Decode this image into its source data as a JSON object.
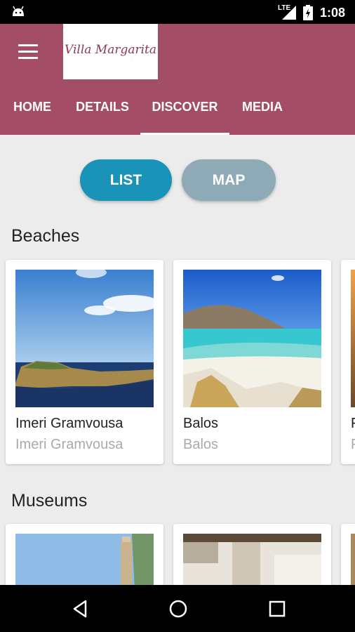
{
  "status_bar": {
    "network": "LTE",
    "time": "1:08"
  },
  "logo": {
    "text": "Villa Margarita",
    "subtext": "·"
  },
  "tabs": [
    {
      "label": "HOME"
    },
    {
      "label": "DETAILS"
    },
    {
      "label": "DISCOVER",
      "active": true
    },
    {
      "label": "MEDIA"
    }
  ],
  "view_toggle": {
    "list_label": "LIST",
    "map_label": "MAP"
  },
  "sections": {
    "beaches": {
      "title": "Beaches",
      "cards": [
        {
          "title": "Imeri Gramvousa",
          "subtitle": "Imeri Gramvousa"
        },
        {
          "title": "Balos",
          "subtitle": "Balos"
        },
        {
          "title": "F",
          "subtitle": "F"
        }
      ]
    },
    "museums": {
      "title": "Museums"
    }
  },
  "colors": {
    "app_bar": "#a34d66",
    "list_button": "#1a93b8",
    "map_button": "#8eaab6",
    "background": "#ececec"
  }
}
